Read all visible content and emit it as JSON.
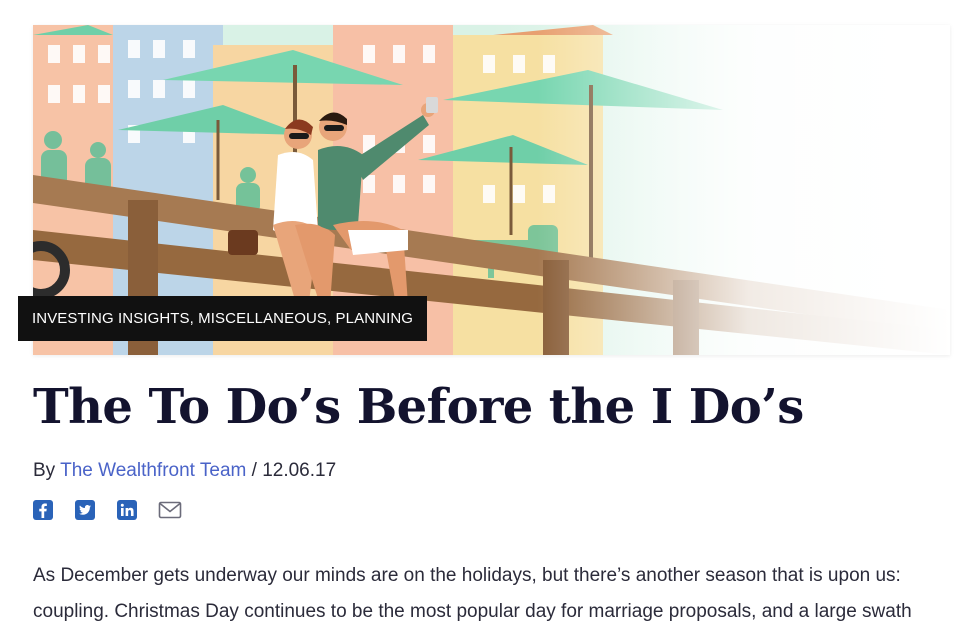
{
  "hero": {
    "categories": "INVESTING INSIGHTS, MISCELLANEOUS, PLANNING"
  },
  "article": {
    "title": "The To Do’s Before the I Do’s",
    "by_prefix": "By",
    "author": "The Wealthfront Team",
    "separator": "/",
    "date": "12.06.17",
    "paragraph_line1": "As December gets underway our minds are on the holidays, but there’s another season that is upon us:",
    "paragraph_line2": "coupling. Christmas Day continues to be the most popular day for marriage proposals, and a large swath"
  },
  "share": {
    "icons": [
      "facebook-icon",
      "twitter-icon",
      "linkedin-icon",
      "email-icon"
    ]
  },
  "colors": {
    "title": "#13132e",
    "link": "#4a63c8",
    "share_icon": "#2a63b8",
    "badge_bg": "#111111",
    "umbrella": "#72d4ad",
    "railing": "#a67a52"
  }
}
